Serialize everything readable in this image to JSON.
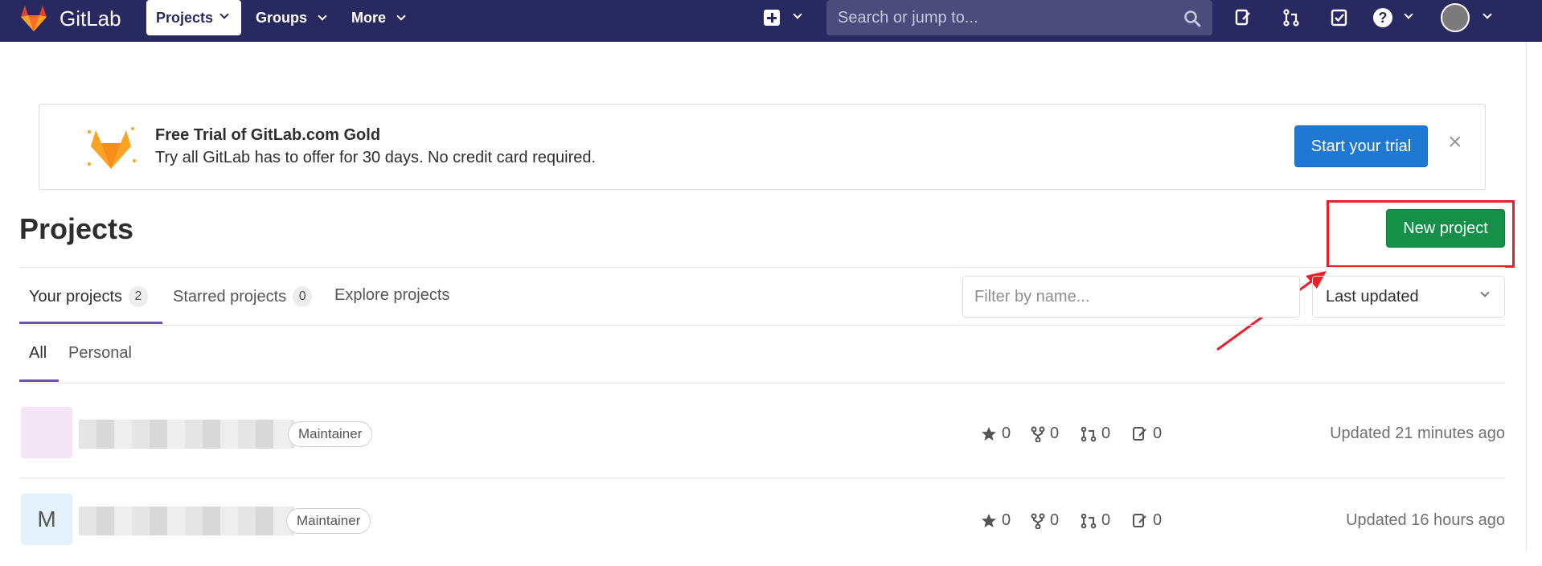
{
  "navbar": {
    "brand": "GitLab",
    "projects_label": "Projects",
    "groups_label": "Groups",
    "more_label": "More",
    "search_placeholder": "Search or jump to..."
  },
  "banner": {
    "title": "Free Trial of GitLab.com Gold",
    "text": "Try all GitLab has to offer for 30 days. No credit card required.",
    "cta": "Start your trial",
    "close": "×"
  },
  "page": {
    "title": "Projects",
    "new_project": "New project"
  },
  "tabs": [
    {
      "label": "Your projects",
      "count": "2"
    },
    {
      "label": "Starred projects",
      "count": "0"
    },
    {
      "label": "Explore projects"
    }
  ],
  "filter": {
    "placeholder": "Filter by name...",
    "sort": "Last updated"
  },
  "subtabs": [
    "All",
    "Personal"
  ],
  "projects": [
    {
      "avatar_letter": "",
      "avatar_color": "#f3e5f5",
      "role": "Maintainer",
      "stars": "0",
      "forks": "0",
      "merge_requests": "0",
      "issues": "0",
      "updated": "Updated 21 minutes ago"
    },
    {
      "avatar_letter": "M",
      "avatar_color": "#e3f2fd",
      "role": "Maintainer",
      "stars": "0",
      "forks": "0",
      "merge_requests": "0",
      "issues": "0",
      "updated": "Updated 16 hours ago"
    }
  ],
  "colors": {
    "navbar": "#292961",
    "trial_button": "#1f78d1",
    "new_project_button": "#168f48",
    "highlight": "#e8202a",
    "tab_underline": "#6b4fbb"
  }
}
